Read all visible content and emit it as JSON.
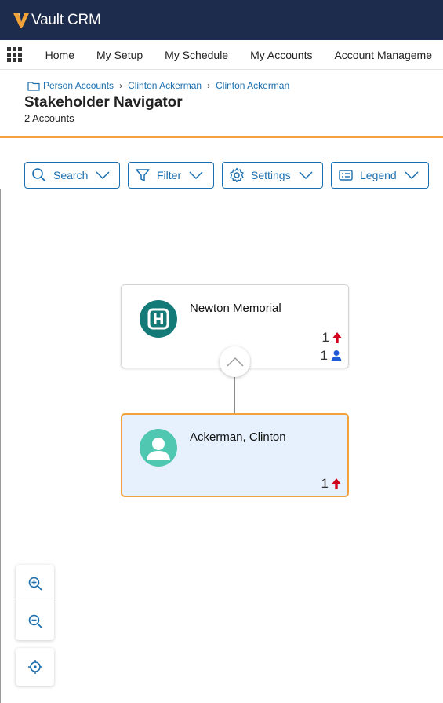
{
  "app": {
    "title": "Vault CRM",
    "brand_color": "#f2a23a",
    "topbar_color": "#1d2c4c"
  },
  "nav": {
    "items": [
      {
        "label": "Home"
      },
      {
        "label": "My Setup"
      },
      {
        "label": "My Schedule"
      },
      {
        "label": "My Accounts"
      },
      {
        "label": "Account Manageme"
      }
    ]
  },
  "breadcrumb": {
    "items": [
      "Person Accounts",
      "Clinton Ackerman",
      "Clinton Ackerman"
    ]
  },
  "page": {
    "title": "Stakeholder Navigator",
    "subtitle": "2 Accounts"
  },
  "toolbar": {
    "search": "Search",
    "filter": "Filter",
    "settings": "Settings",
    "legend": "Legend"
  },
  "nodes": {
    "parent": {
      "name": "Newton Memorial",
      "icon": "hospital-icon",
      "stat_up": "1",
      "stat_people": "1"
    },
    "child": {
      "name": "Ackerman, Clinton",
      "icon": "person-icon",
      "stat_up": "1"
    }
  },
  "colors": {
    "accent": "#1a6fb0",
    "arrow_red": "#d0021b",
    "person_blue": "#1f5bd6",
    "selected_bg": "#e7f1fd"
  }
}
